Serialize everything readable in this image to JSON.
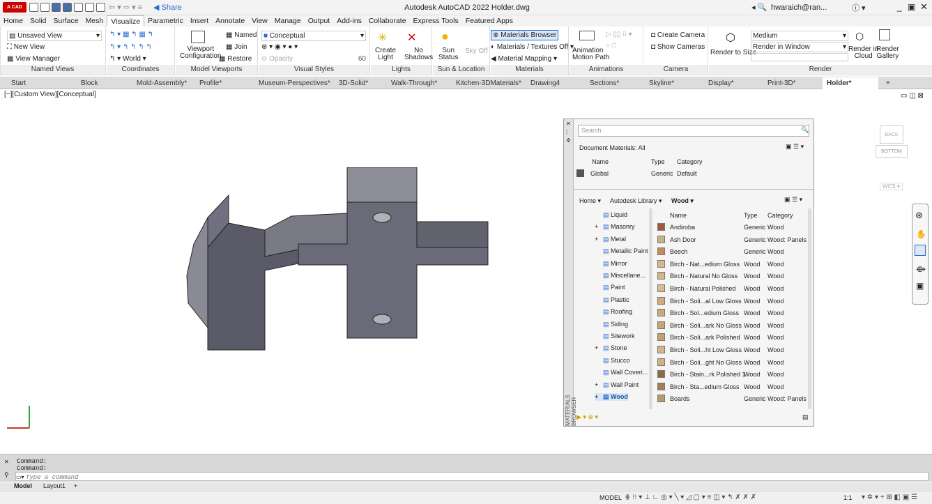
{
  "app": {
    "logo": "A CAD",
    "title": "Autodesk AutoCAD 2022  Holder.dwg",
    "share": "Share",
    "user": "hwaraich@ran...",
    "window_controls": [
      "_",
      "□",
      "✕"
    ]
  },
  "ribbon_tabs": [
    "Home",
    "Solid",
    "Surface",
    "Mesh",
    "Visualize",
    "Parametric",
    "Insert",
    "Annotate",
    "View",
    "Manage",
    "Output",
    "Add-ins",
    "Collaborate",
    "Express Tools",
    "Featured Apps"
  ],
  "active_ribbon_tab": "Visualize",
  "panels": {
    "named_views": {
      "label": "Named Views",
      "unsaved": "Unsaved View",
      "new_view": "New View",
      "view_manager": "View Manager"
    },
    "coordinates": {
      "label": "Coordinates",
      "world": "World"
    },
    "model_viewports": {
      "label": "Model Viewports",
      "viewport_config": "Viewport\nConfiguration",
      "named": "Named",
      "join": "Join",
      "restore": "Restore"
    },
    "visual_styles": {
      "label": "Visual Styles",
      "style": "Conceptual",
      "opacity": "Opacity",
      "opacity_value": "60"
    },
    "lights": {
      "label": "Lights",
      "create_light": "Create\nLight",
      "no_shadows": "No\nShadows"
    },
    "sun": {
      "label": "Sun & Location",
      "sun_status": "Sun\nStatus",
      "sky_off": "Sky Off"
    },
    "materials": {
      "label": "Materials",
      "browser": "Materials Browser",
      "textures": "Materials / Textures Off",
      "mapping": "Material Mapping"
    },
    "animations": {
      "label": "Animations",
      "motion_path": "Animation\nMotion Path"
    },
    "camera": {
      "label": "Camera",
      "create": "Create Camera",
      "show": "Show Cameras"
    },
    "render": {
      "label": "Render",
      "render_to_size": "Render to Size",
      "quality": "Medium",
      "render_in": "Render in Window",
      "render_cloud": "Render in\nCloud",
      "gallery": "Render\nGallery"
    }
  },
  "doc_tabs": [
    "Start",
    "Block",
    "Mold-Assembly*",
    "Profile*",
    "Museum-Perspectives*",
    "3D-Solid*",
    "Walk-Through*",
    "Kitchen-3DMaterials*",
    "Drawing4",
    "Sections*",
    "Skyline*",
    "Display*",
    "Print-3D*",
    "Holder*"
  ],
  "active_doc_tab": "Holder*",
  "viewport_label": "[−][Custom View][Conceptual]",
  "material_browser": {
    "side_label": "MATERIALS BROWSER",
    "search_placeholder": "Search",
    "doc_materials_header": "Document Materials: All",
    "doc_cols": [
      "Name",
      "Type",
      "Category"
    ],
    "doc_rows": [
      {
        "name": "Global",
        "type": "Generic",
        "category": "Default"
      }
    ],
    "library_home": "Home",
    "library_name": "Autodesk Library",
    "library_sel": "Wood",
    "tree": [
      {
        "label": "Liquid",
        "exp": ""
      },
      {
        "label": "Masonry",
        "exp": "+"
      },
      {
        "label": "Metal",
        "exp": "+"
      },
      {
        "label": "Metallic Paint",
        "exp": ""
      },
      {
        "label": "Mirror",
        "exp": ""
      },
      {
        "label": "Miscellane...",
        "exp": ""
      },
      {
        "label": "Paint",
        "exp": ""
      },
      {
        "label": "Plastic",
        "exp": ""
      },
      {
        "label": "Roofing",
        "exp": ""
      },
      {
        "label": "Siding",
        "exp": ""
      },
      {
        "label": "Sitework",
        "exp": ""
      },
      {
        "label": "Stone",
        "exp": "+"
      },
      {
        "label": "Stucco",
        "exp": ""
      },
      {
        "label": "Wall Coveri...",
        "exp": ""
      },
      {
        "label": "Wall Paint",
        "exp": "+"
      },
      {
        "label": "Wood",
        "exp": "+"
      }
    ],
    "lib_cols": [
      "Name",
      "Type",
      "Category"
    ],
    "lib_rows": [
      {
        "name": "Andiroba",
        "type": "Generic",
        "category": "Wood",
        "color": "#a0583a"
      },
      {
        "name": "Ash Door",
        "type": "Generic",
        "category": "Wood: Panels",
        "color": "#c9b48a"
      },
      {
        "name": "Beech",
        "type": "Generic",
        "category": "Wood",
        "color": "#c98a5a"
      },
      {
        "name": "Birch - Nat...edium Gloss",
        "type": "Wood",
        "category": "Wood",
        "color": "#d6b98a"
      },
      {
        "name": "Birch - Natural No Gloss",
        "type": "Wood",
        "category": "Wood",
        "color": "#d2b585"
      },
      {
        "name": "Birch - Natural Polished",
        "type": "Wood",
        "category": "Wood",
        "color": "#d8bb8c"
      },
      {
        "name": "Birch - Soli...al Low Gloss",
        "type": "Wood",
        "category": "Wood",
        "color": "#cfae7a"
      },
      {
        "name": "Birch - Sol...edium Gloss",
        "type": "Wood",
        "category": "Wood",
        "color": "#ccaa78"
      },
      {
        "name": "Birch - Soli...ark No Gloss",
        "type": "Wood",
        "category": "Wood",
        "color": "#c8a573"
      },
      {
        "name": "Birch - Soli...ark Polished",
        "type": "Wood",
        "category": "Wood",
        "color": "#c4a170"
      },
      {
        "name": "Birch - Soli...ht Low Gloss",
        "type": "Wood",
        "category": "Wood",
        "color": "#d4b584"
      },
      {
        "name": "Birch - Soli...ght No Gloss",
        "type": "Wood",
        "category": "Wood",
        "color": "#d1b281"
      },
      {
        "name": "Birch - Stain...rk Polished 1",
        "type": "Wood",
        "category": "Wood",
        "color": "#8e6a44"
      },
      {
        "name": "Birch - Sta...edium Gloss",
        "type": "Wood",
        "category": "Wood",
        "color": "#a57e52"
      },
      {
        "name": "Boards",
        "type": "Generic",
        "category": "Wood: Panels",
        "color": "#b99a6c"
      }
    ]
  },
  "navcube": {
    "top": "BACK",
    "face": "BOTTOM",
    "wcs": "WCS"
  },
  "command": {
    "line1": "Command:",
    "line2": "Command:",
    "placeholder": "Type a command"
  },
  "layout_tabs": [
    "Model",
    "Layout1",
    "+"
  ],
  "status": {
    "model": "MODEL",
    "scale": "1:1"
  }
}
